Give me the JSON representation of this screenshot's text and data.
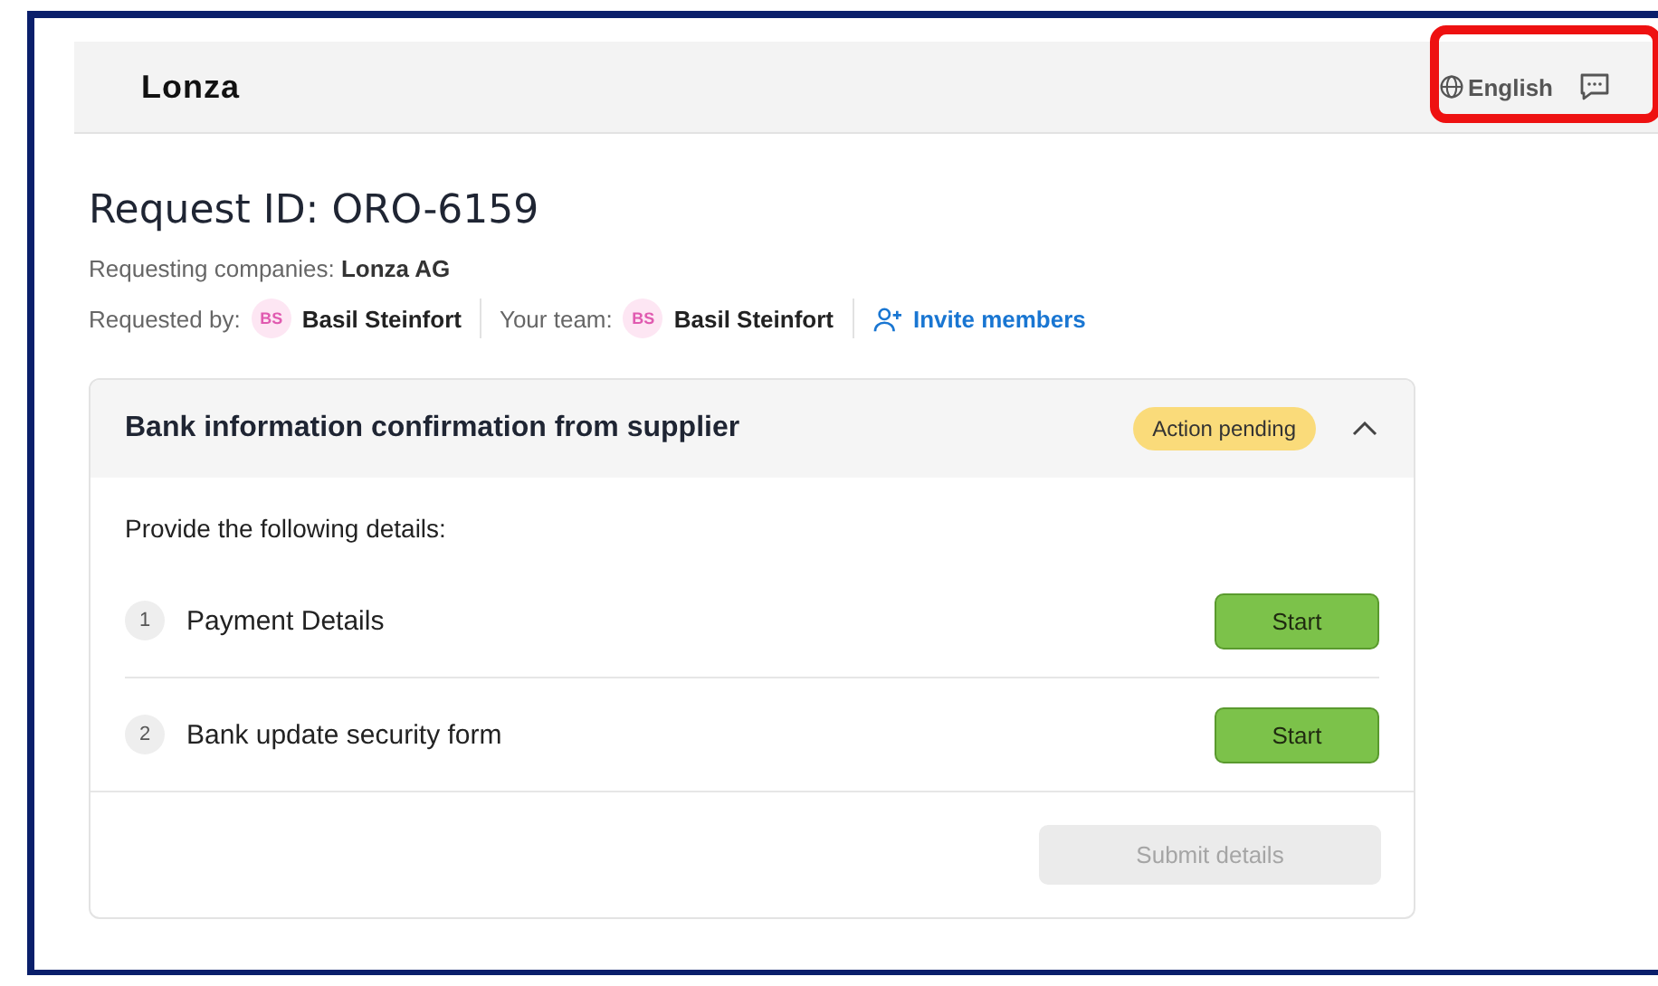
{
  "header": {
    "logo": "Lonza",
    "language": "English",
    "highlighted": true
  },
  "request": {
    "title": "Request ID: ORO-6159",
    "companies_label": "Requesting companies:",
    "companies": "Lonza AG",
    "requested_by_label": "Requested by:",
    "requested_by": {
      "initials": "BS",
      "name": "Basil Steinfort"
    },
    "team_label": "Your team:",
    "team": [
      {
        "initials": "BS",
        "name": "Basil Steinfort"
      }
    ],
    "invite": "Invite members"
  },
  "card": {
    "title": "Bank information confirmation from supplier",
    "status": "Action pending",
    "expanded": true,
    "intro": "Provide the following details:",
    "steps": [
      {
        "number": "1",
        "label": "Payment Details",
        "action": "Start"
      },
      {
        "number": "2",
        "label": "Bank update security form",
        "action": "Start"
      }
    ],
    "submit": {
      "label": "Submit details",
      "disabled": true
    }
  }
}
